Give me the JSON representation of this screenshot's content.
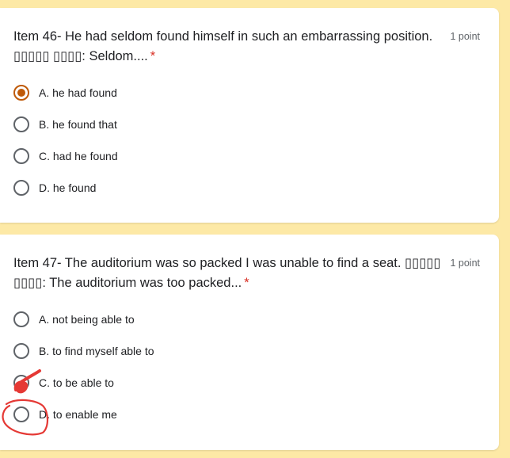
{
  "questions": [
    {
      "title": "Item 46- He had seldom found himself in such an embarrassing position.",
      "prompt": "▯▯▯▯▯ ▯▯▯▯: Seldom....",
      "points": "1 point",
      "required_mark": "*",
      "options": [
        "A. he had found",
        "B. he found that",
        "C. had he found",
        "D. he found"
      ],
      "selected": "A. he had found"
    },
    {
      "title": "Item 47- The auditorium was so packed I was unable to find a seat. ▯▯▯▯▯",
      "prompt": "▯▯▯▯: The auditorium was too packed...",
      "points": "1 point",
      "required_mark": "*",
      "options": [
        "A. not being able to",
        "B. to find myself able to",
        "C. to be able to",
        "D. to enable me"
      ],
      "selected": null
    }
  ],
  "colors": {
    "page_background": "#fde9a6",
    "accent": "#bf5a09",
    "required": "#d93025",
    "annotation_ink": "#e53935"
  },
  "annotations": {
    "check_mark_on": "C. to be able to",
    "circle_on": "D. to enable me"
  }
}
